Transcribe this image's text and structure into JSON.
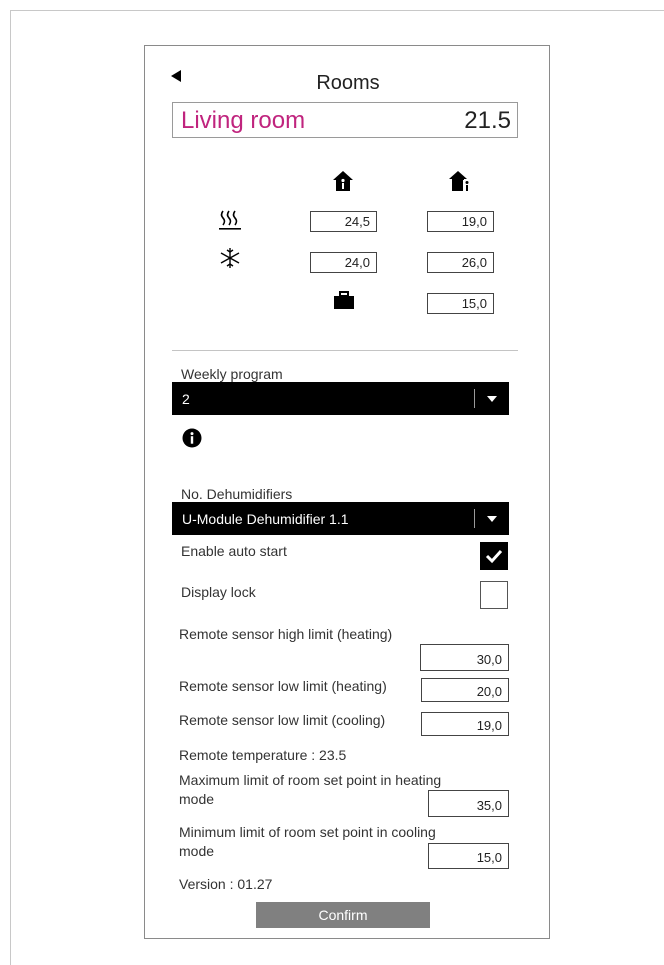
{
  "header": {
    "title": "Rooms",
    "room_name": "Living room",
    "room_temperature": "21.5"
  },
  "setpoints": {
    "heating": {
      "comfort": "24,5",
      "economy": "19,0"
    },
    "cooling": {
      "comfort": "24,0",
      "economy": "26,0"
    },
    "away": "15,0"
  },
  "weekly_program": {
    "label": "Weekly program",
    "value": "2"
  },
  "dehumidifiers": {
    "label": "No. Dehumidifiers",
    "value": "U-Module Dehumidifier 1.1"
  },
  "options": {
    "auto_start_label": "Enable auto start",
    "auto_start_checked": true,
    "display_lock_label": "Display lock",
    "display_lock_checked": false
  },
  "limits": {
    "remote_high_heating_label": "Remote sensor high limit (heating)",
    "remote_high_heating_value": "30,0",
    "remote_low_heating_label": "Remote sensor low limit (heating)",
    "remote_low_heating_value": "20,0",
    "remote_low_cooling_label": "Remote sensor low limit (cooling)",
    "remote_low_cooling_value": "19,0",
    "remote_temperature_text": "Remote temperature : 23.5",
    "max_heating_label_line1": "Maximum limit of room set point in heating",
    "max_heating_label_line2": "mode",
    "max_heating_value": "35,0",
    "min_cooling_label_line1": "Minimum limit of room set point in cooling",
    "min_cooling_label_line2": "mode",
    "min_cooling_value": "15,0"
  },
  "footer": {
    "version_text": "Version : 01.27",
    "confirm_label": "Confirm"
  },
  "icons": {
    "home_comfort": "home-icon",
    "home_economy": "home-info-icon",
    "heating": "heating-waves-icon",
    "cooling": "snowflake-icon",
    "away": "suitcase-icon",
    "info": "info-icon",
    "check": "check-icon"
  },
  "colors": {
    "room_name": "#c0247e",
    "dropdown_bg": "#000000",
    "confirm_bg": "#808080"
  }
}
